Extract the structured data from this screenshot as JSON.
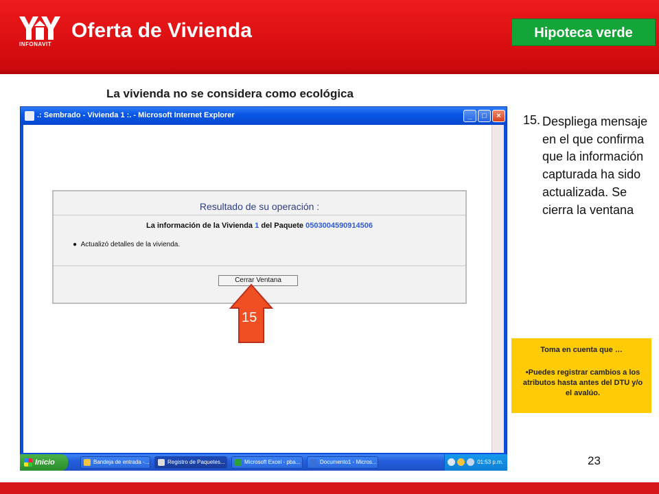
{
  "header": {
    "logo_text": "INFONAVIT",
    "title": "Oferta de Vivienda",
    "badge": "Hipoteca verde"
  },
  "subtitle": "La vivienda no se considera como ecológica",
  "ie_window": {
    "title": ".: Sembrado - Vivienda 1 :. - Microsoft Internet Explorer",
    "controls": {
      "minimize": "_",
      "maximize": "□",
      "close": "×"
    }
  },
  "result_panel": {
    "title": "Resultado de su operación :",
    "info_prefix": "La información de la Vivienda",
    "vivienda": "1",
    "info_middle": "del Paquete",
    "paquete": "0503004590914506",
    "bullet": "Actualizó detalles de la vivienda.",
    "button": "Cerrar Ventana"
  },
  "arrow_label": "15",
  "taskbar": {
    "start": "Inicio",
    "items": [
      "Bandeja de entrada -...",
      "Registro de Paquetes...",
      "Microsoft Excel - pba...",
      "Documento1 - Micros..."
    ],
    "time": "01:53 p.m."
  },
  "instruction": {
    "number": "15.",
    "text": "Despliega mensaje en el que confirma que la información capturada ha sido actualizada. Se cierra la ventana"
  },
  "note": {
    "title": "Toma en cuenta que …",
    "body": "•Puedes registrar cambios  a los atributos hasta antes  del DTU  y/o el avalúo."
  },
  "page_number": "23",
  "colors": {
    "header_red": "#dc0f12",
    "badge_green": "#13a538",
    "arrow_orange": "#f04e23",
    "note_yellow": "#ffcb05",
    "footer_red": "#d7141a"
  }
}
